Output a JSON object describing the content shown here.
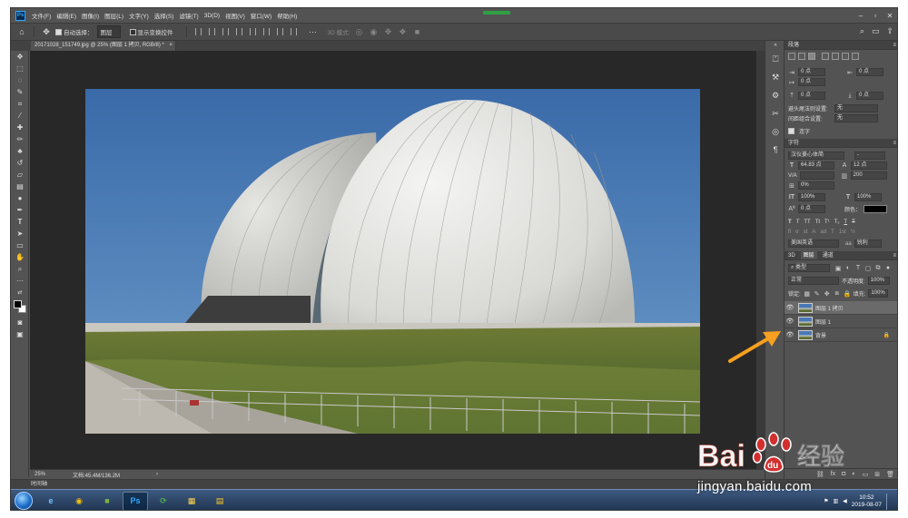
{
  "menubar": {
    "logo": "Ps",
    "items": [
      "文件(F)",
      "编辑(E)",
      "图像(I)",
      "图层(L)",
      "文字(Y)",
      "选择(S)",
      "滤镜(T)",
      "3D(D)",
      "视图(V)",
      "窗口(W)",
      "帮助(H)"
    ],
    "min": "–",
    "restore": "▫",
    "close": "✕"
  },
  "optbar": {
    "auto_select_label": "自动选择：",
    "auto_select_value": "图层",
    "show_transform_label": "显示变换控件",
    "mode_label": "3D 模式:",
    "more": "···"
  },
  "document": {
    "tab_title": "20171028_151749.jpg @ 25% (图层 1 拷贝, RGB/8) *",
    "tab_close": "×",
    "zoom": "25%",
    "doc_info": "文档:45.4M/136.2M",
    "status_arrow": "›"
  },
  "timeline": {
    "label": "时间轴"
  },
  "paragraph_panel": {
    "title": "段落",
    "indent_left": "0 点",
    "indent_right": "0 点",
    "first_line": "0 点",
    "space_before": "0 点",
    "space_after": "0 点",
    "kinsoku_label": "避头尾法则设置:",
    "kinsoku_value": "无",
    "mojikumi_label": "间距组合设置:",
    "mojikumi_value": "无",
    "hyphenate_label": "连字"
  },
  "character_panel": {
    "title": "字符",
    "font_family": "汉仪菱心体简",
    "font_style": "-",
    "font_size": "64.83 点",
    "leading": "12 点",
    "kerning": "V/A",
    "tracking": "200",
    "scale_percent": "0%",
    "vertical_scale": "100%",
    "horizontal_scale": "100%",
    "baseline_shift": "0 点",
    "color_label": "颜色：",
    "language": "美国英语",
    "antialias_icon": "aa",
    "antialias": "锐利",
    "style_buttons": [
      "T",
      "T",
      "TT",
      "Tt",
      "T¹",
      "T₁",
      "T",
      "T"
    ],
    "ot_buttons": [
      "fi",
      "σ",
      "st",
      "A",
      "ad",
      "T",
      "1st",
      "½"
    ]
  },
  "layers_panel": {
    "tabs": [
      "3D",
      "图层",
      "通道"
    ],
    "active_tab": 1,
    "filter_label": "类型",
    "blend_mode": "正常",
    "opacity_label": "不透明度:",
    "opacity": "100%",
    "lock_label": "锁定:",
    "fill_label": "填充:",
    "fill": "100%",
    "layers": [
      {
        "name": "图层 1 拷贝",
        "selected": true,
        "locked": false
      },
      {
        "name": "图层 1",
        "selected": false,
        "locked": false
      },
      {
        "name": "背景",
        "selected": false,
        "locked": true
      }
    ]
  },
  "taskbar": {
    "clock_time": "10:52",
    "clock_date": "2019-08-07"
  },
  "watermark": {
    "brand": "Bai",
    "brand_cn": "经验",
    "url": "jingyan.baidu.com"
  },
  "colors": {
    "ps_bg": "#535353",
    "canvas_bg": "#282828",
    "arrow": "#f5a020",
    "sky": "#3f73b0"
  }
}
